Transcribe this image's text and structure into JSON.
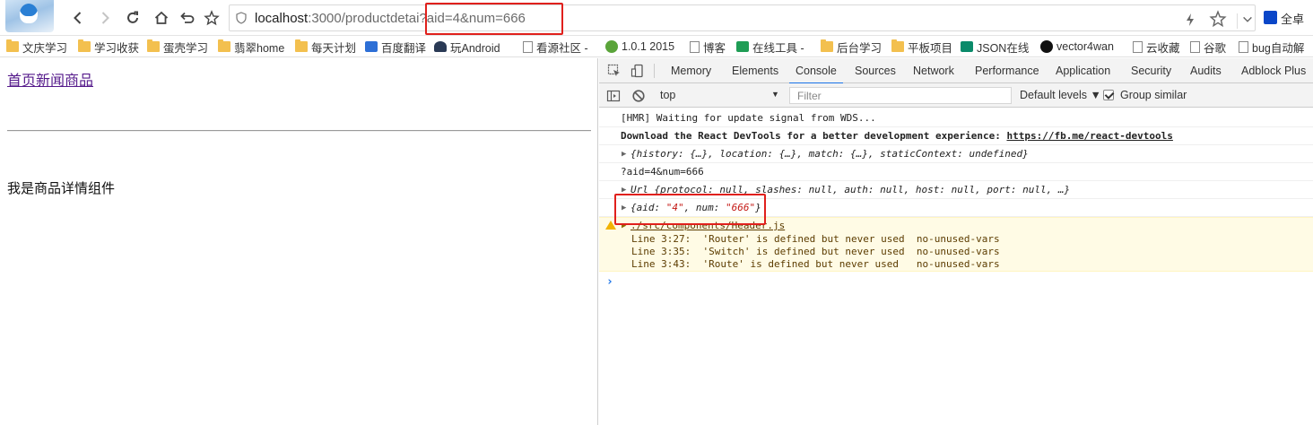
{
  "colors": {
    "highlight": "#e0201c",
    "accent": "#1a73e8",
    "visited_link": "#551a8b",
    "warning_bg": "#fffbe5"
  },
  "toolbar": {
    "url_host": "localhost",
    "url_rest": ":3000/productdetai",
    "url_query": "?aid=4&num=666",
    "extension_label": "全卓"
  },
  "bookmarks": [
    {
      "label": "文庆学习",
      "icon": "folder-icon"
    },
    {
      "label": "学习收获",
      "icon": "folder-icon"
    },
    {
      "label": "蛋壳学习",
      "icon": "folder-icon"
    },
    {
      "label": "翡翠home",
      "icon": "folder-icon"
    },
    {
      "label": "每天计划",
      "icon": "folder-icon"
    },
    {
      "label": "百度翻译",
      "icon": "translate-icon"
    },
    {
      "label": "玩Android",
      "icon": "android-icon"
    },
    {
      "label": "看源社区 -",
      "icon": "page-icon"
    },
    {
      "label": "1.0.1 2015",
      "icon": "globe-icon"
    },
    {
      "label": "博客",
      "icon": "page-icon"
    },
    {
      "label": "在线工具 -",
      "icon": "tool-icon"
    },
    {
      "label": "后台学习",
      "icon": "folder-icon"
    },
    {
      "label": "平板项目",
      "icon": "folder-icon"
    },
    {
      "label": "JSON在线",
      "icon": "json-icon"
    },
    {
      "label": "vector4wan",
      "icon": "github-icon"
    },
    {
      "label": "云收藏",
      "icon": "page-icon"
    },
    {
      "label": "谷歌",
      "icon": "page-icon"
    },
    {
      "label": "bug自动解",
      "icon": "page-icon"
    }
  ],
  "page": {
    "nav_link": "首页新闻商品",
    "detail_text": "我是商品详情组件"
  },
  "devtools": {
    "tabs": [
      "Memory",
      "Elements",
      "Console",
      "Sources",
      "Network",
      "Performance",
      "Application",
      "Security",
      "Audits",
      "Adblock Plus"
    ],
    "active_tab": "Console",
    "context": "top",
    "filter_placeholder": "Filter",
    "levels": "Default levels ▼",
    "group_similar": "Group similar",
    "messages": {
      "hmr": "[HMR] Waiting for update signal from WDS...",
      "devtools_prefix": "Download the React DevTools for a better development experience: ",
      "devtools_link": "https://fb.me/react-devtools",
      "props_obj": "{history: {…}, location: {…}, match: {…}, staticContext: undefined}",
      "search": "?aid=4&num=666",
      "url_obj": "Url {protocol: null, slashes: null, auth: null, host: null, port: null, …}",
      "query_open": "{aid: ",
      "query_aid": "\"4\"",
      "query_mid": ", num: ",
      "query_num": "\"666\"",
      "query_close": "}",
      "warn_file": "./src/components/Header.js",
      "warn_lines": [
        "Line 3:27:  'Router' is defined but never used  no-unused-vars",
        "Line 3:35:  'Switch' is defined but never used  no-unused-vars",
        "Line 3:43:  'Route' is defined but never used   no-unused-vars"
      ]
    }
  }
}
